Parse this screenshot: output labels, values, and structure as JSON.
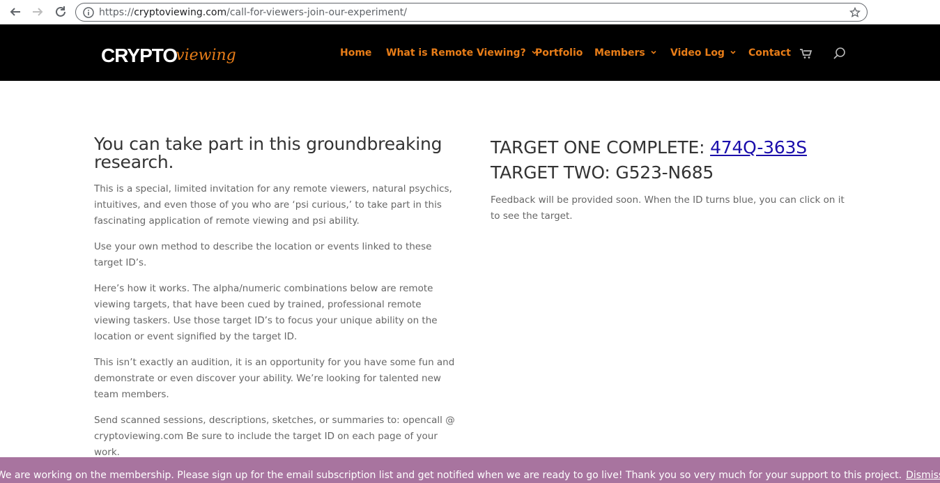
{
  "browser": {
    "url_scheme": "https://",
    "url_host": "cryptoviewing.com",
    "url_path": "/call-for-viewers-join-our-experiment/"
  },
  "header": {
    "logo_main": "CRYPTO",
    "logo_script": "viewing",
    "accent_color": "#e87d18",
    "menu": [
      {
        "label": "Home",
        "has_dropdown": false
      },
      {
        "label": "What is Remote Viewing?",
        "has_dropdown": true
      },
      {
        "label": "Portfolio",
        "has_dropdown": false
      },
      {
        "label": "Members",
        "has_dropdown": true
      },
      {
        "label": "Video Log",
        "has_dropdown": true
      },
      {
        "label": "Contact",
        "has_dropdown": false
      }
    ],
    "icons": [
      "cart-icon",
      "search-icon"
    ]
  },
  "left": {
    "headline": "You can take part in this groundbreaking research.",
    "paragraphs": [
      "This is a special, limited invitation for any remote viewers, natural psychics, intuitives, and even those of you who are ‘psi curious,’ to take part in this fascinating application of remote viewing and psi ability.",
      "Use your own method to describe the location or events linked to these target ID’s.",
      "Here’s how it works. The alpha/numeric combinations below are remote viewing targets, that have been cued by trained, professional remote viewing taskers. Use those target ID’s to focus your unique ability on the location or event signified by the target ID.",
      "This isn’t exactly an audition, it is an opportunity for you have some fun and demonstrate or even discover your ability. We’re looking for talented new team members.",
      "Send scanned sessions, descriptions, sketches, or summaries to: opencall @ cryptoviewing.com Be sure to include the target ID on each page of your work."
    ]
  },
  "right": {
    "target_one_label": "TARGET ONE COMPLETE: ",
    "target_one_id": "474Q-363S",
    "target_two_label": "TARGET TWO: ",
    "target_two_id": "G523-N685",
    "feedback": "Feedback will be provided soon. When the ID turns blue, you can click on it to see the target.",
    "link_color": "#1a0dab"
  },
  "notice": {
    "text": "We are working on the membership. Please sign up for the email subscription list and get notified when we are ready to go live! Thank you so very much for your support to this project.",
    "dismiss": "Dismiss",
    "background": "#a8749f"
  }
}
